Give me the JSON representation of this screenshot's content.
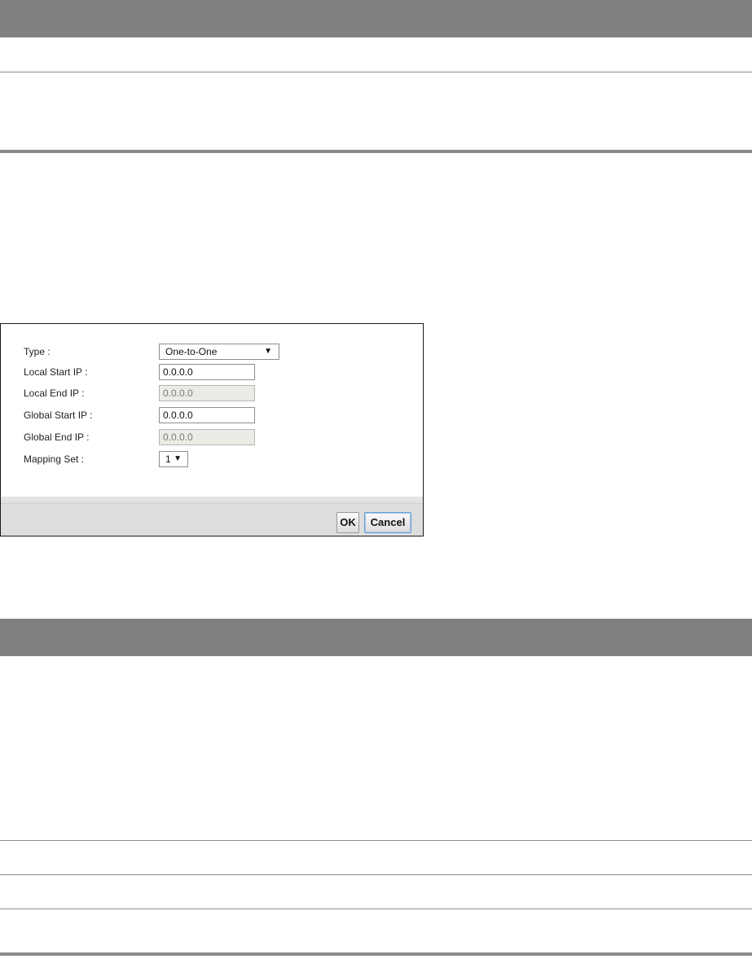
{
  "dialog": {
    "fields": [
      {
        "label": "Type :",
        "kind": "select",
        "value": "One-to-One",
        "arrow": "▼"
      },
      {
        "label": "Local Start IP :",
        "kind": "text",
        "value": "0.0.0.0"
      },
      {
        "label": "Local End IP :",
        "kind": "text-disabled",
        "value": "0.0.0.0"
      },
      {
        "label": "Global Start IP :",
        "kind": "text",
        "value": "0.0.0.0"
      },
      {
        "label": "Global End IP :",
        "kind": "text-disabled",
        "value": "0.0.0.0"
      },
      {
        "label": "Mapping Set :",
        "kind": "select",
        "value": "1",
        "arrow": "▼"
      }
    ],
    "ok_label": "OK",
    "cancel_label": "Cancel"
  },
  "colors": {
    "header_bar": "#808080",
    "dialog_border": "#1a1a1a",
    "footer_bg": "#dedede",
    "focus_border": "#6c9bd2"
  }
}
